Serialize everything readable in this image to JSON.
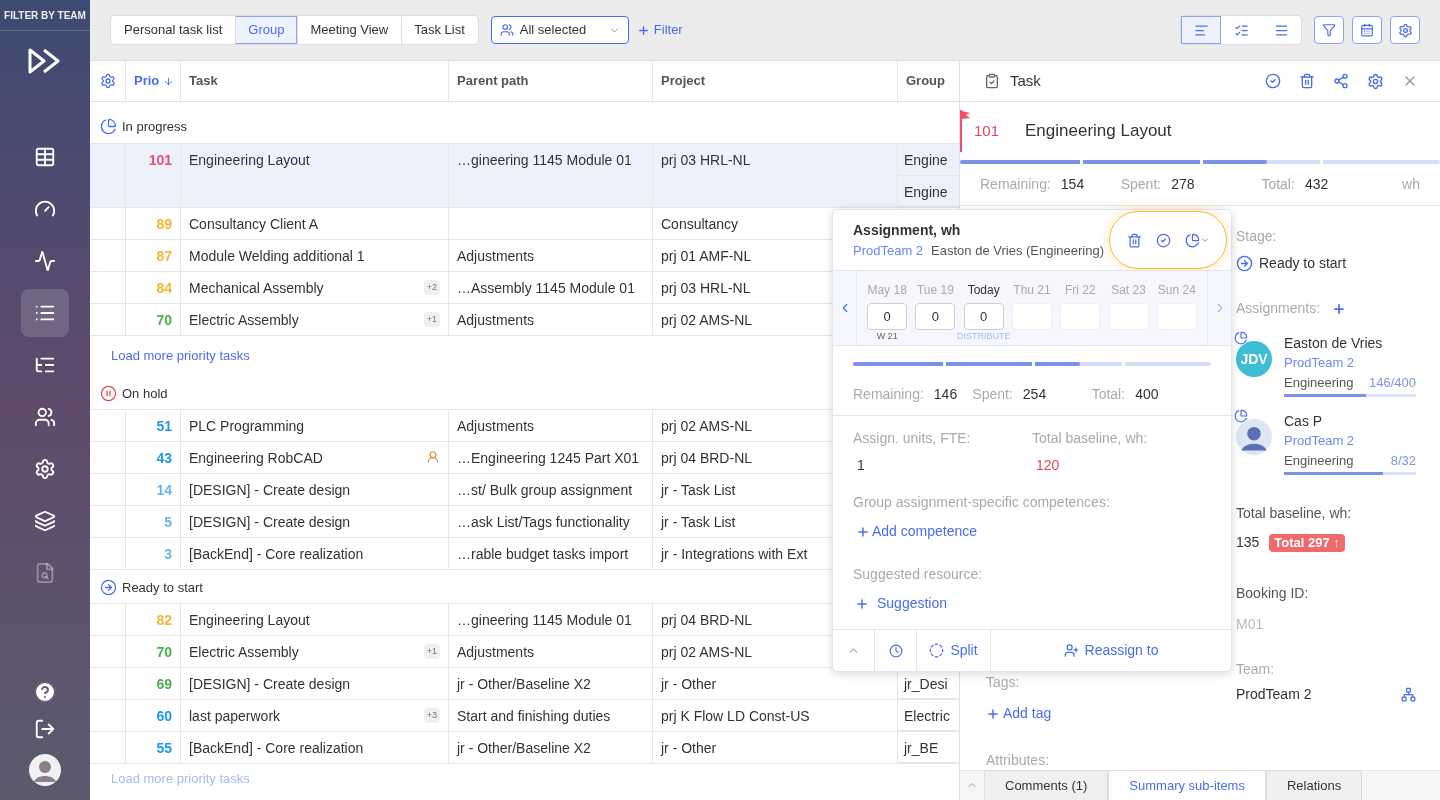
{
  "sidebar": {
    "header": "FILTER BY TEAM",
    "nav": [
      {
        "selected": false,
        "disabled": false
      },
      {
        "selected": false,
        "disabled": false
      },
      {
        "selected": false,
        "disabled": false
      },
      {
        "selected": true,
        "disabled": false
      },
      {
        "selected": false,
        "disabled": false
      },
      {
        "selected": false,
        "disabled": false
      },
      {
        "selected": false,
        "disabled": false
      },
      {
        "selected": false,
        "disabled": false
      },
      {
        "selected": false,
        "disabled": true
      }
    ]
  },
  "toolbar": {
    "tabs": [
      {
        "label": "Personal task list",
        "selected": false
      },
      {
        "label": "Group",
        "selected": true
      },
      {
        "label": "Meeting View",
        "selected": false
      },
      {
        "label": "Task List",
        "selected": false
      }
    ],
    "team_filter": "All selected",
    "filter_link": "Filter",
    "views": [
      {
        "selected": true
      },
      {
        "selected": false
      },
      {
        "selected": false
      }
    ]
  },
  "table": {
    "columns": [
      {
        "label": "Prio",
        "sorted": true
      },
      {
        "label": "Task",
        "sorted": false
      },
      {
        "label": "Parent path",
        "sorted": false
      },
      {
        "label": "Project",
        "sorted": false
      },
      {
        "label": "Group",
        "sorted": false
      }
    ],
    "sections": [
      {
        "kind": "in-progress",
        "title": "In progress",
        "load_more": "Load more priority tasks",
        "rows": [
          {
            "prio": "101",
            "color": "#f0506e",
            "task": "Engineering Layout",
            "parent": "…gineering 1145 Module 01",
            "project": "prj 03 HRL-NL",
            "group": [
              "Engine",
              "Engine"
            ],
            "selected": true
          },
          {
            "prio": "89",
            "color": "#f5b731",
            "task": "Consultancy Client A",
            "project": "Consultancy",
            "selected": false
          },
          {
            "prio": "87",
            "color": "#f5b731",
            "task": "Module Welding additional 1",
            "parent": "Adjustments",
            "project": "prj 01 AMF-NL",
            "selected": false
          },
          {
            "prio": "84",
            "color": "#f5b731",
            "task": "Mechanical Assembly",
            "marker": {
              "kind": "count",
              "text": "+2"
            },
            "parent": "…Assembly 1145 Module 01",
            "project": "prj 03 HRL-NL",
            "selected": false
          },
          {
            "prio": "70",
            "color": "#4caf50",
            "task": "Electric Assembly",
            "marker": {
              "kind": "count",
              "text": "+1"
            },
            "parent": "Adjustments",
            "project": "prj 02 AMS-NL",
            "selected": false
          }
        ]
      },
      {
        "kind": "on-hold",
        "title": "On hold",
        "rows": [
          {
            "prio": "51",
            "color": "#2196f3",
            "task": "PLC Programming",
            "parent": "Adjustments",
            "project": "prj 02 AMS-NL",
            "selected": false
          },
          {
            "prio": "43",
            "color": "#2196f3",
            "task": "Engineering RobCAD",
            "marker": {
              "kind": "cost"
            },
            "parent": "…Engineering 1245 Part X01",
            "project": "prj 04 BRD-NL",
            "selected": false
          },
          {
            "prio": "14",
            "color": "#64b5f6",
            "task": "[DESIGN] - Create design",
            "parent": "…st/ Bulk group assignment",
            "project": "jr - Task List",
            "selected": false
          },
          {
            "prio": "5",
            "color": "#64b5f6",
            "task": "[DESIGN] - Create design",
            "parent": "…ask List/Tags functionality",
            "project": "jr - Task List",
            "selected": false
          },
          {
            "prio": "3",
            "color": "#64b5f6",
            "task": "[BackEnd] - Core realization",
            "parent": "…rable budget tasks import",
            "project": "jr - Integrations with Ext",
            "selected": false
          }
        ]
      },
      {
        "kind": "ready",
        "title": "Ready to start",
        "load_more": "Load more priority tasks",
        "rows": [
          {
            "prio": "82",
            "color": "#f5b731",
            "task": "Engineering Layout",
            "parent": "…gineering 1145 Module 01",
            "project": "prj 04 BRD-NL",
            "selected": false
          },
          {
            "prio": "70",
            "color": "#4caf50",
            "task": "Electric Assembly",
            "marker": {
              "kind": "count",
              "text": "+1"
            },
            "parent": "Adjustments",
            "project": "prj 02 AMS-NL",
            "selected": false
          },
          {
            "prio": "69",
            "color": "#4caf50",
            "task": "[DESIGN] - Create design",
            "parent": "jr - Other/Baseline X2",
            "project": "jr - Other",
            "group": [
              "jr_Desi"
            ],
            "selected": false
          },
          {
            "prio": "60",
            "color": "#2196f3",
            "task": "last paperwork",
            "marker": {
              "kind": "count",
              "text": "+3"
            },
            "parent": "Start and finishing duties",
            "project": "prj K Flow LD Const-US",
            "group": [
              "Electric"
            ],
            "selected": false
          },
          {
            "prio": "55",
            "color": "#2196f3",
            "task": "[BackEnd] - Core realization",
            "parent": "jr - Other/Baseline X2",
            "project": "jr - Other",
            "group": [
              "jr_BE"
            ],
            "selected": false
          }
        ]
      }
    ]
  },
  "task_panel": {
    "title": "Task",
    "flagged": true,
    "prio": "101",
    "name": "Engineering Layout",
    "level": 0.64,
    "stats": [
      {
        "label": "Remaining:",
        "value": "154"
      },
      {
        "label": "Spent:",
        "value": "278"
      },
      {
        "label": "Total:",
        "value": "432"
      }
    ],
    "unit": "wh",
    "stage_label": "Stage:",
    "stage": "Ready to start",
    "assignments_label": "Assignments:",
    "assignees": [
      {
        "kind": "initials",
        "initials": "JDV",
        "name": "Easton de Vries",
        "team": "ProdTeam 2",
        "role": "Engineering",
        "hours": "146/400",
        "level": 0.62
      },
      {
        "kind": "figure",
        "name": "Cas P",
        "team": "ProdTeam 2",
        "role": "Engineering",
        "hours": "8/32",
        "level": 0.75
      }
    ],
    "baseline_label": "Total baseline, wh:",
    "baseline": "135",
    "baseline_badge": "Total 297 ↑",
    "booking_label": "Booking ID:",
    "booking": "M01",
    "team_label": "Team:",
    "team": "ProdTeam 2",
    "tags_label": "Tags:",
    "add_tag": "Add tag",
    "attributes_label": "Attributes:",
    "tabs": [
      {
        "label": "Comments (1)",
        "selected": false
      },
      {
        "label": "Summary sub-items",
        "selected": true
      },
      {
        "label": "Relations",
        "selected": false
      }
    ]
  },
  "assignment_popup": {
    "title": "Assignment, wh",
    "team": "ProdTeam 2",
    "person": "Easton de Vries (Engineering)",
    "days": [
      {
        "label": "May 18",
        "value": "0",
        "note": "W 21",
        "current": false
      },
      {
        "label": "Tue 19",
        "value": "0",
        "current": false
      },
      {
        "label": "Today",
        "value": "0",
        "note": "DISTRIBUTE",
        "current": true
      },
      {
        "label": "Thu 21",
        "current": false
      },
      {
        "label": "Fri 22",
        "current": false
      },
      {
        "label": "Sat 23",
        "current": false
      },
      {
        "label": "Sun 24",
        "current": false
      }
    ],
    "level": 0.635,
    "stats": [
      {
        "label": "Remaining:",
        "value": "146"
      },
      {
        "label": "Spent:",
        "value": "254"
      },
      {
        "label": "Total:",
        "value": "400"
      }
    ],
    "units_label": "Assign. units, FTE:",
    "units": "1",
    "baseline_label": "Total baseline, wh:",
    "baseline": "120",
    "competences_label": "Group assignment-specific competences:",
    "add_competence": "Add competence",
    "suggested_label": "Suggested resource:",
    "suggestion": "Suggestion",
    "split": "Split",
    "reassign": "Reassign to"
  }
}
